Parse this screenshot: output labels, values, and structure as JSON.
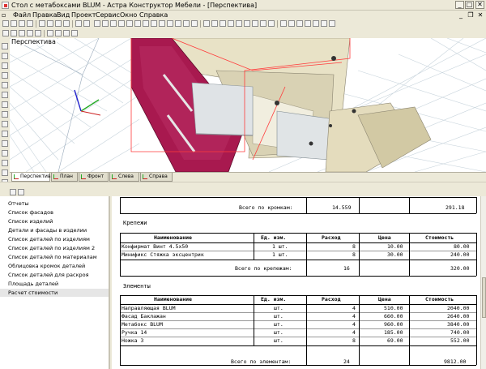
{
  "window": {
    "title": "Стол с метабоксами BLUM - Астра Конструктор Мебели - [Перспектива]",
    "minimize": "_",
    "maximize": "□",
    "close": "✕",
    "mdi_minimize": "_",
    "mdi_restore": "❐",
    "mdi_close": "✕"
  },
  "menu": [
    "Файл",
    "Правка",
    "Вид",
    "Проект",
    "Сервис",
    "Окно",
    "Справка"
  ],
  "viewport": {
    "label": "Перспектива",
    "accent_color": "#a8194f",
    "panel_color": "#d9d2b4"
  },
  "view_tabs": [
    "Перспектива",
    "План",
    "Фронт",
    "Слева",
    "Справа"
  ],
  "sidebar": {
    "items": [
      "Отчеты",
      "Список фасадов",
      "Список изделий",
      "Детали и фасады в изделии",
      "Список деталей по изделиям",
      "Список деталей по изделиям 2",
      "Список деталей по материалам",
      "Облицовка кромок деталей",
      "Список деталей для раскроя",
      "Площадь деталей",
      "Расчет стоимости"
    ],
    "selected_index": 10
  },
  "report": {
    "edges_total_label": "Всего по кромкам:",
    "edges_total_qty": "14.559",
    "edges_total_cost": "291.18",
    "fasteners": {
      "title": "Крепежи",
      "headers": [
        "Наименование",
        "Ед. изм.",
        "Расход",
        "Цена",
        "Стоимость"
      ],
      "rows": [
        [
          "Конфирмат Винт 4.5x50",
          "1 шт.",
          "8",
          "10.00",
          "80.00"
        ],
        [
          "Минификс Стяжка эксцентрик",
          "1 шт.",
          "8",
          "30.00",
          "240.00"
        ]
      ],
      "total_label": "Всего по крепежам:",
      "total_qty": "16",
      "total_cost": "320.00"
    },
    "elements": {
      "title": "Элементы",
      "headers": [
        "Наименование",
        "Ед. изм.",
        "Расход",
        "Цена",
        "Стоимость"
      ],
      "rows": [
        [
          "Направляющая BLUM",
          "шт.",
          "4",
          "510.00",
          "2040.00"
        ],
        [
          "Фасад Баклажан",
          "шт.",
          "4",
          "660.00",
          "2640.00"
        ],
        [
          "Метабокс BLUM",
          "шт.",
          "4",
          "960.00",
          "3840.00"
        ],
        [
          "Ручка 14",
          "шт.",
          "4",
          "185.00",
          "740.00"
        ],
        [
          "Ножка 3",
          "шт.",
          "8",
          "69.00",
          "552.00"
        ]
      ],
      "total_label": "Всего по элементам:",
      "total_qty": "24",
      "total_cost": "9812.00"
    }
  }
}
